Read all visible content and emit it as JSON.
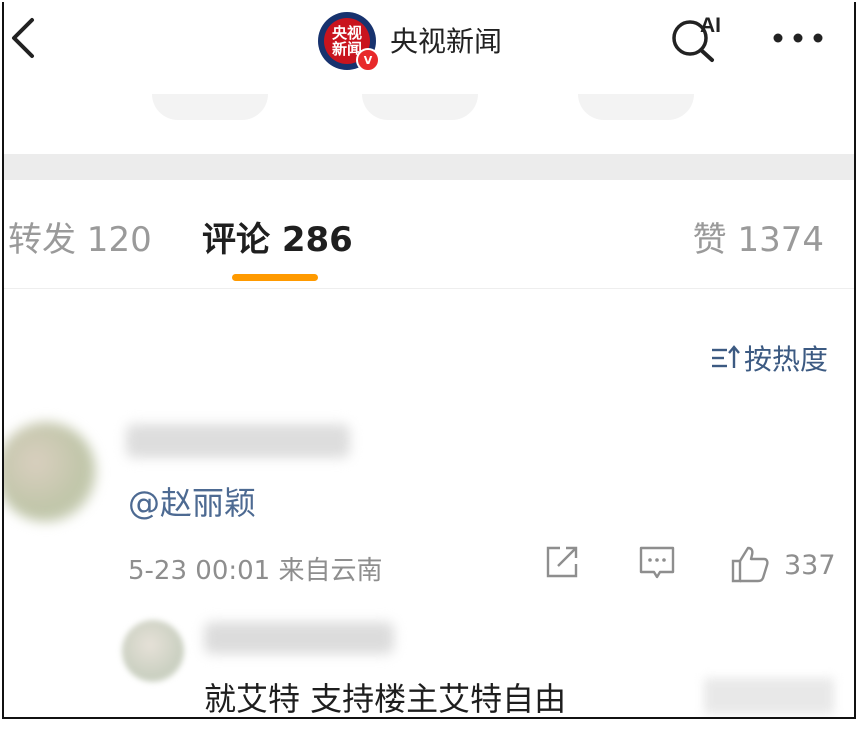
{
  "header": {
    "account_name": "央视新闻",
    "logo_text_line1": "央视",
    "logo_text_line2": "新闻",
    "verified_mark": "V",
    "ai_label": "AI"
  },
  "tabs": [
    {
      "label": "转发 120"
    },
    {
      "label": "评论 286"
    },
    {
      "label": "赞 1374"
    }
  ],
  "sort": {
    "label": "按热度"
  },
  "comments": [
    {
      "text": "@赵丽颖",
      "meta": "5-23 00:01  来自云南",
      "likes": "337"
    },
    {
      "text": "就艾特 支持楼主艾特自由"
    }
  ],
  "colors": {
    "accent_underline": "#ff9a00",
    "link_blue": "#4d6a92",
    "muted_gray": "#8e8e8e"
  }
}
